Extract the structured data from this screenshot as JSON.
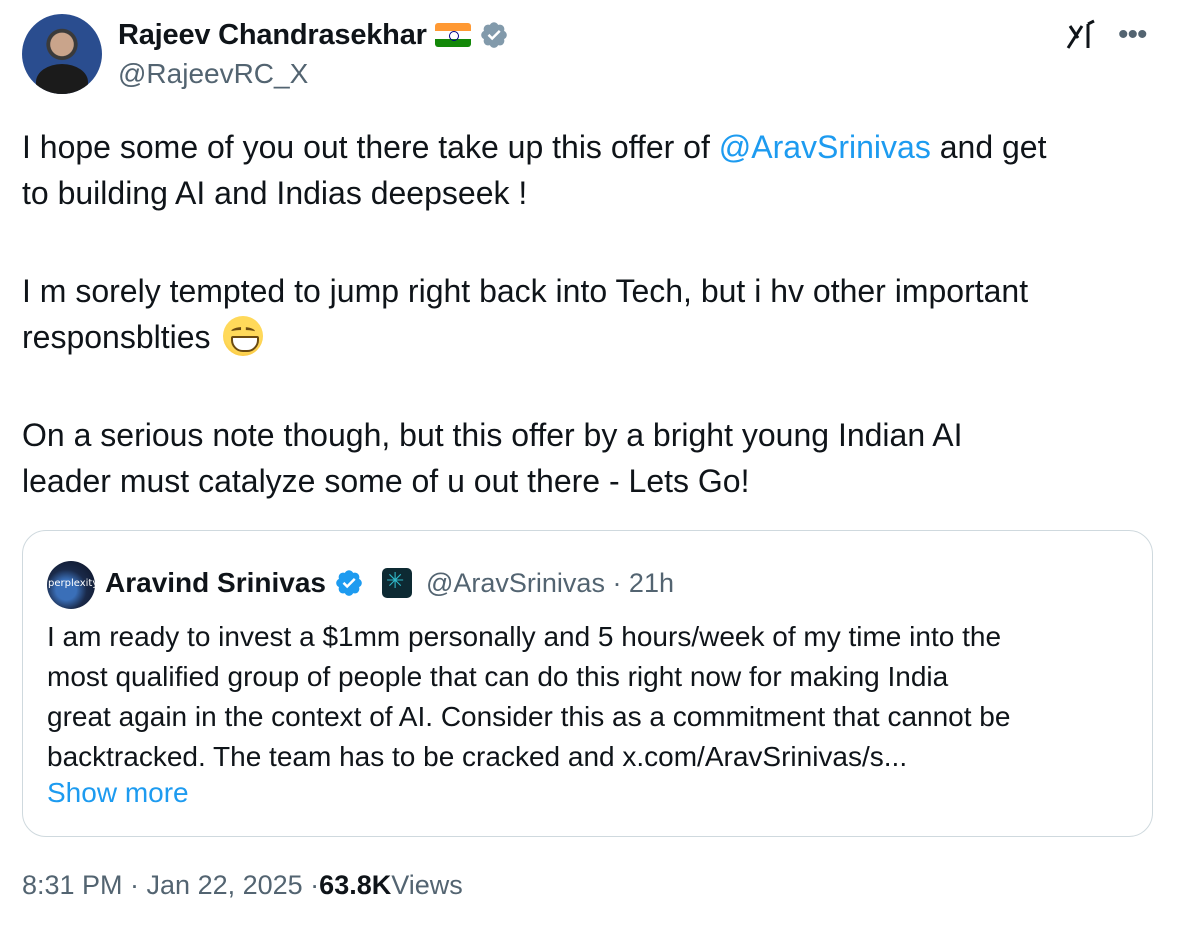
{
  "author": {
    "name": "Rajeev Chandrasekhar",
    "handle": "@RajeevRC_X"
  },
  "body": {
    "line1_before": "I hope some of you out there take up this offer of ",
    "line1_mention": "@AravSrinivas",
    "line1_after": " and get",
    "line2": "to building AI and Indias deepseek !",
    "line3": "I m sorely tempted to jump right back into Tech, but i hv other important",
    "line4": "responsblties",
    "line5": "On a serious note though, but this offer by a bright young Indian AI",
    "line6": "leader must catalyze some of u out there - Lets Go!"
  },
  "quote": {
    "avatar_text": "perplexity",
    "name": "Aravind Srinivas",
    "meta": "@AravSrinivas · 21h",
    "lines": [
      "I am ready to invest a $1mm personally and 5 hours/week of my time into the",
      "most qualified group of people that can do this right now for making India",
      "great again in the context of AI. Consider this as a commitment that cannot be",
      "backtracked. The team has to be cracked and x.com/AravSrinivas/s..."
    ],
    "show_more": "Show more"
  },
  "footer": {
    "time": "8:31 PM · Jan 22, 2025 · ",
    "views_count": "63.8K",
    "views_label": " Views"
  },
  "icons": {
    "verified": "verified-badge-icon",
    "flag": "india-flag-icon",
    "grok": "grok-icon",
    "more": "more-options-icon",
    "emoji": "grinning-face-emoji-icon",
    "affiliate": "perplexity-affiliate-icon"
  },
  "colors": {
    "link": "#1d9bf0",
    "secondary_text": "#536471",
    "border": "#cfd9de"
  }
}
